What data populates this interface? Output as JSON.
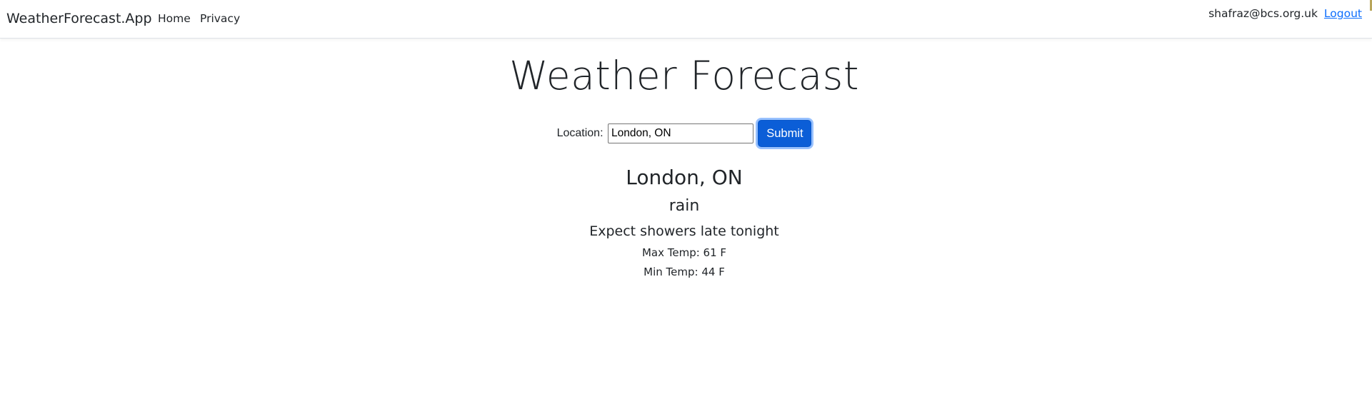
{
  "navbar": {
    "brand": "WeatherForecast.App",
    "links": [
      "Home",
      "Privacy"
    ],
    "user_email": "shafraz@bcs.org.uk",
    "logout_label": "Logout"
  },
  "page": {
    "title": "Weather Forecast"
  },
  "form": {
    "location_label": "Location:",
    "location_value": "London, ON",
    "submit_label": "Submit"
  },
  "result": {
    "location": "London, ON",
    "condition": "rain",
    "description": "Expect showers late tonight",
    "max_temp": "Max Temp: 61 F",
    "min_temp": "Min Temp: 44 F"
  },
  "colors": {
    "accent": "#0b5ed7",
    "link": "#0d6efd",
    "text": "#212529"
  }
}
